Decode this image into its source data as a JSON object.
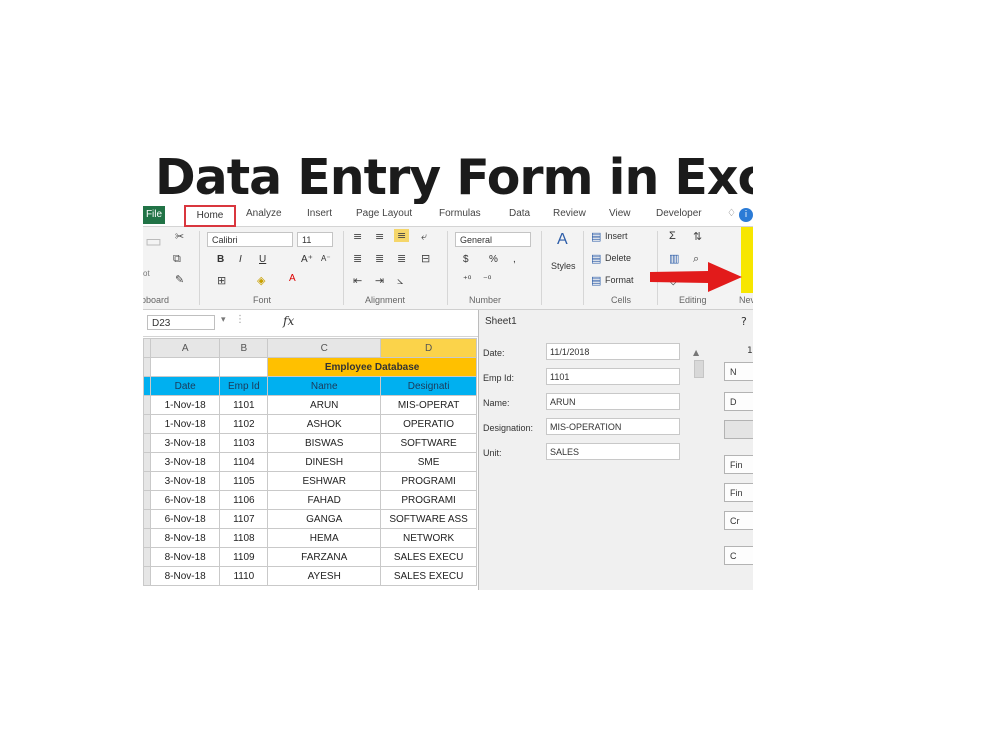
{
  "title": "Data Entry Form in Exce",
  "ribbon": {
    "tabs": [
      "File",
      "Home",
      "Analyze",
      "Insert",
      "Page Layout",
      "Formulas",
      "Data",
      "Review",
      "View",
      "Developer"
    ],
    "font_name": "Calibri",
    "font_size": "11",
    "number_format": "General",
    "styles_label": "Styles",
    "insert_label": "Insert",
    "delete_label": "Delete",
    "format_label": "Format",
    "groups": [
      "ipboard",
      "Font",
      "Alignment",
      "Number",
      "Cells",
      "Editing",
      "Nev"
    ],
    "clipboard_sub": "ot",
    "help_glyph": "♢",
    "info_glyph": "i",
    "accent_color": "#217346",
    "highlight_color": "#d9363e"
  },
  "formula_bar": {
    "name_box": "D23",
    "fx": "fx"
  },
  "sheet": {
    "columns": [
      "A",
      "B",
      "C",
      "D"
    ],
    "row_nums": [
      "",
      "",
      "",
      "",
      "",
      "",
      "",
      "",
      "",
      "",
      "",
      "",
      "",
      ""
    ],
    "db_title": "Employee Database",
    "headers": [
      "Date",
      "Emp Id",
      "Name",
      "Designati"
    ],
    "rows": [
      [
        "1-Nov-18",
        "1101",
        "ARUN",
        "MIS-OPERAT"
      ],
      [
        "1-Nov-18",
        "1102",
        "ASHOK",
        "OPERATIO"
      ],
      [
        "3-Nov-18",
        "1103",
        "BISWAS",
        "SOFTWARE"
      ],
      [
        "3-Nov-18",
        "1104",
        "DINESH",
        "SME"
      ],
      [
        "3-Nov-18",
        "1105",
        "ESHWAR",
        "PROGRAMI"
      ],
      [
        "6-Nov-18",
        "1106",
        "FAHAD",
        "PROGRAMI"
      ],
      [
        "6-Nov-18",
        "1107",
        "GANGA",
        "SOFTWARE ASS"
      ],
      [
        "8-Nov-18",
        "1108",
        "HEMA",
        "NETWORK"
      ],
      [
        "8-Nov-18",
        "1109",
        "FARZANA",
        "SALES EXECU"
      ],
      [
        "8-Nov-18",
        "1110",
        "AYESH",
        "SALES EXECU"
      ]
    ]
  },
  "dialog": {
    "title": "Sheet1",
    "help": "?",
    "record": "1",
    "fields": [
      {
        "label": "Date:",
        "value": "11/1/2018"
      },
      {
        "label": "Emp Id:",
        "value": "1101"
      },
      {
        "label": "Name:",
        "value": "ARUN"
      },
      {
        "label": "Designation:",
        "value": "MIS-OPERATION"
      },
      {
        "label": "Unit:",
        "value": "SALES"
      }
    ],
    "buttons": [
      "N",
      "D",
      "",
      "Fin",
      "Fin",
      "Cr",
      "C"
    ]
  }
}
